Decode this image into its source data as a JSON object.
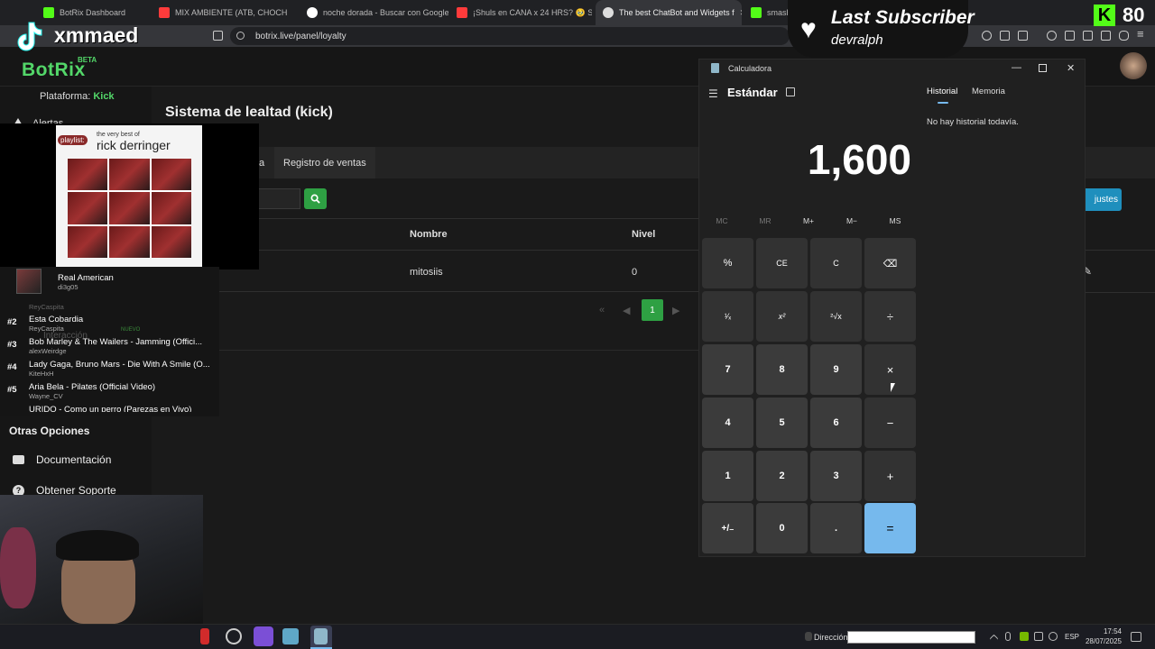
{
  "browser": {
    "tabs": [
      {
        "title": "BotRix Dashboard",
        "color": "#53fc18"
      },
      {
        "title": "MIX AMBIENTE (ATB, CHOCH",
        "color": "#ff3b3b"
      },
      {
        "title": "noche dorada - Buscar con Google",
        "color": "#ffffff"
      },
      {
        "title": "¡Shuls en CANA x 24 HRS? 🥹 Si",
        "color": "#ff3b3b"
      },
      {
        "title": "The best ChatBot and Widgets f",
        "color": "#dddddd"
      },
      {
        "title": "smashdo",
        "color": "#53fc18"
      }
    ],
    "url": "botrix.live/panel/loyalty"
  },
  "overlay": {
    "tiktok_name": "xmmaed",
    "last_subscriber_title": "Last Subscriber",
    "last_subscriber_name": "devralph",
    "kick_count": "80",
    "kick_letter": "K",
    "album_small": "the very best of",
    "album_artist": "rick derringer",
    "album_playlist": "playlist:",
    "playlist": {
      "now_playing": {
        "title": "Real American",
        "requester": "di3g05"
      },
      "items": [
        {
          "num": "#2",
          "title": "Esta Cobardia",
          "requester": "ReyCaspita"
        },
        {
          "num": "#3",
          "title": "Bob Marley & The Wailers - Jamming (Offici...",
          "requester": "alexWeirdge"
        },
        {
          "num": "#4",
          "title": "Lady Gaga, Bruno Mars - Die With A Smile (O...",
          "requester": "KiteHxH"
        },
        {
          "num": "#5",
          "title": "Aria Bela - Pilates (Official Video)",
          "requester": "Wayne_CV"
        },
        {
          "num": "",
          "title": "URIDO - Como un perro (Parezas en Vivo)",
          "requester": ""
        }
      ],
      "ghost_text": [
        "ReyCaspita",
        "RevCaspita",
        "Interacción",
        "NUEVO"
      ]
    }
  },
  "app": {
    "logo": "BotRix",
    "beta": "BETA",
    "platform_label": "Plataforma:",
    "platform_value": "Kick",
    "sidebar_partial": "Alertas",
    "page_title": "Sistema de lealtad (kick)",
    "tabs": [
      "a",
      "Registro de ventas"
    ],
    "table": {
      "headers": [
        "Nombre",
        "Nivel"
      ],
      "rows": [
        {
          "nombre": "mitosiis",
          "nivel": "0"
        }
      ]
    },
    "pagination": {
      "current": "1"
    },
    "settings_button": "justes",
    "sidebar": {
      "section_title": "Otras Opciones",
      "items": [
        "Documentación",
        "Obtener Soporte"
      ]
    }
  },
  "calculator": {
    "window_title": "Calculadora",
    "mode": "Estándar",
    "display": "1,600",
    "memory": [
      "MC",
      "MR",
      "M+",
      "M−",
      "MS"
    ],
    "keys": [
      [
        "%",
        "CE",
        "C",
        "⌫"
      ],
      [
        "¹⁄ₓ",
        "x²",
        "²√x",
        "÷"
      ],
      [
        "7",
        "8",
        "9",
        "×"
      ],
      [
        "4",
        "5",
        "6",
        "−"
      ],
      [
        "1",
        "2",
        "3",
        "+"
      ],
      [
        "+/₋",
        "0",
        ".",
        "="
      ]
    ],
    "history_tab": "Historial",
    "memory_tab": "Memoria",
    "history_empty": "No hay historial todavía.",
    "accent": "#76b9ed"
  },
  "taskbar": {
    "address_label": "Dirección",
    "language": "ESP",
    "time": "17:54",
    "date": "28/07/2025"
  }
}
